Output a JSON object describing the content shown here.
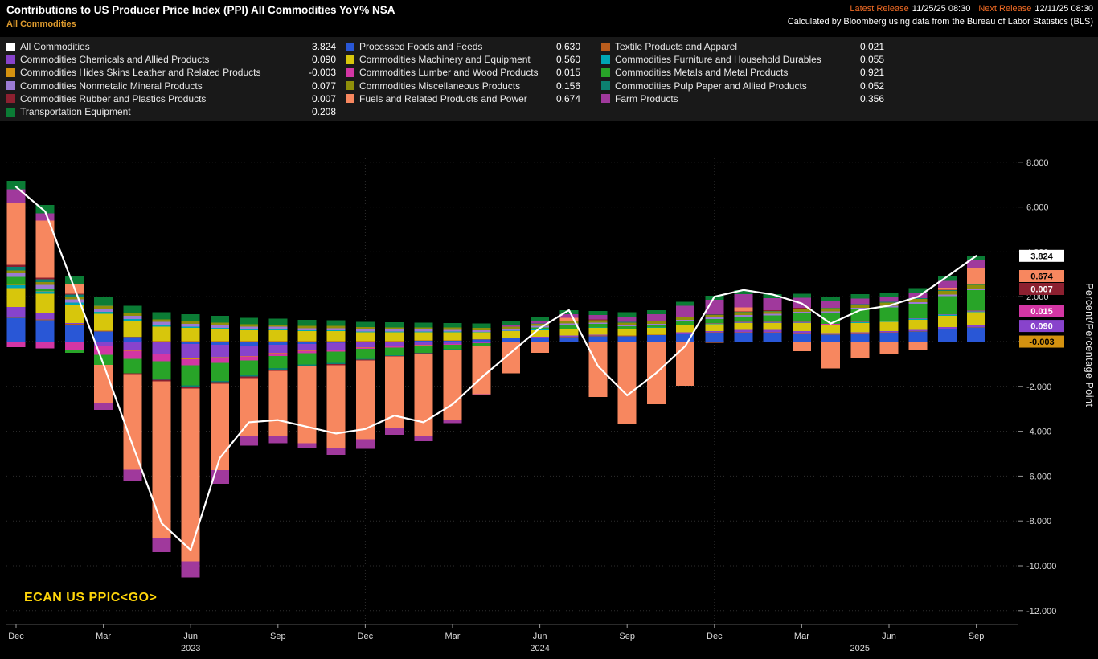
{
  "header": {
    "title": "Contributions to US Producer Price Index (PPI) All Commodities YoY% NSA",
    "subtitle": "All Commodities",
    "latest_release_label": "Latest Release",
    "latest_release_value": "11/25/25 08:30",
    "next_release_label": "Next Release",
    "next_release_value": "12/11/25 08:30",
    "attribution": "Calculated by Bloomberg using data from the Bureau of Labor Statistics (BLS)"
  },
  "footer_command": "ECAN US PPIC<GO>",
  "axis": {
    "right_title": "Percent/Percentage Point"
  },
  "legend": {
    "columns": [
      {
        "items": [
          {
            "series": "all_commodities",
            "label": "All Commodities",
            "value": "3.824"
          },
          {
            "series": "chemicals",
            "label": "Commodities Chemicals and Allied Products",
            "value": "0.090"
          },
          {
            "series": "hides",
            "label": "Commodities Hides Skins Leather and Related Products",
            "value": "-0.003"
          },
          {
            "series": "nonmetalic_minerals",
            "label": "Commodities Nonmetalic Mineral Products",
            "value": "0.077"
          },
          {
            "series": "rubber_plastics",
            "label": "Commodities Rubber and Plastics Products",
            "value": "0.007"
          },
          {
            "series": "transportation",
            "label": "Transportation Equipment",
            "value": "0.208"
          }
        ]
      },
      {
        "items": [
          {
            "series": "processed_foods",
            "label": "Processed Foods and Feeds",
            "value": "0.630"
          },
          {
            "series": "machinery",
            "label": "Commodities Machinery and Equipment",
            "value": "0.560"
          },
          {
            "series": "lumber",
            "label": "Commodities Lumber and Wood Products",
            "value": "0.015"
          },
          {
            "series": "miscellaneous",
            "label": "Commodities Miscellaneous Products",
            "value": "0.156"
          },
          {
            "series": "fuels",
            "label": "Fuels and Related Products and Power",
            "value": "0.674"
          }
        ]
      },
      {
        "items": [
          {
            "series": "textiles",
            "label": "Textile Products and Apparel",
            "value": "0.021"
          },
          {
            "series": "furniture",
            "label": "Commodities Furniture and Household Durables",
            "value": "0.055"
          },
          {
            "series": "metals",
            "label": "Commodities Metals and Metal Products",
            "value": "0.921"
          },
          {
            "series": "pulp_paper",
            "label": "Commodities Pulp Paper and Allied Products",
            "value": "0.052"
          },
          {
            "series": "farm",
            "label": "Farm Products",
            "value": "0.356"
          }
        ]
      }
    ]
  },
  "chart_data": {
    "type": "bar",
    "subtype": "stacked-bar-with-line",
    "title": "Contributions to US Producer Price Index (PPI) All Commodities YoY% NSA",
    "ylabel": "Percent/Percentage Point",
    "ylim": [
      -12.6,
      9.4
    ],
    "grid": true,
    "months": [
      "Dec 2022",
      "Jan 2023",
      "Feb 2023",
      "Mar 2023",
      "Apr 2023",
      "May 2023",
      "Jun 2023",
      "Jul 2023",
      "Aug 2023",
      "Sep 2023",
      "Oct 2023",
      "Nov 2023",
      "Dec 2023",
      "Jan 2024",
      "Feb 2024",
      "Mar 2024",
      "Apr 2024",
      "May 2024",
      "Jun 2024",
      "Jul 2024",
      "Aug 2024",
      "Sep 2024",
      "Oct 2024",
      "Nov 2024",
      "Dec 2024",
      "Jan 2025",
      "Feb 2025",
      "Mar 2025",
      "Apr 2025",
      "May 2025",
      "Jun 2025",
      "Jul 2025",
      "Aug 2025",
      "Sep 2025"
    ],
    "x_ticks": [
      {
        "index": 0,
        "label": "Dec"
      },
      {
        "index": 3,
        "label": "Mar"
      },
      {
        "index": 6,
        "label": "Jun"
      },
      {
        "index": 9,
        "label": "Sep"
      },
      {
        "index": 12,
        "label": "Dec"
      },
      {
        "index": 15,
        "label": "Mar"
      },
      {
        "index": 18,
        "label": "Jun"
      },
      {
        "index": 21,
        "label": "Sep"
      },
      {
        "index": 24,
        "label": "Dec"
      },
      {
        "index": 27,
        "label": "Mar"
      },
      {
        "index": 30,
        "label": "Jun"
      },
      {
        "index": 33,
        "label": "Sep"
      }
    ],
    "year_labels": [
      {
        "index": 6,
        "label": "2023"
      },
      {
        "index": 18,
        "label": "2024"
      },
      {
        "index": 29,
        "label": "2025"
      }
    ],
    "year_separator_indices": [
      12,
      24
    ],
    "y_ticks": [
      {
        "value": 8,
        "label": "8.000"
      },
      {
        "value": 6,
        "label": "6.000"
      },
      {
        "value": 4,
        "label": "4.000"
      },
      {
        "value": 2,
        "label": "2.000"
      },
      {
        "value": 0,
        "label": "0.000"
      },
      {
        "value": -2,
        "label": "-2.000"
      },
      {
        "value": -4,
        "label": "-4.000"
      },
      {
        "value": -6,
        "label": "-6.000"
      },
      {
        "value": -8,
        "label": "-8.000"
      },
      {
        "value": -10,
        "label": "-10.000"
      },
      {
        "value": -12,
        "label": "-12.000"
      }
    ],
    "line": {
      "key": "all_commodities",
      "name": "All Commodities",
      "color": "#ffffff",
      "latest": 3.824,
      "values": [
        6.9,
        5.8,
        2.4,
        -1.0,
        -4.6,
        -8.1,
        -9.3,
        -5.2,
        -3.6,
        -3.5,
        -3.8,
        -4.1,
        -3.9,
        -3.3,
        -3.6,
        -2.8,
        -1.6,
        -0.5,
        0.6,
        1.4,
        -1.1,
        -2.4,
        -1.4,
        -0.2,
        2.0,
        2.3,
        2.1,
        1.7,
        0.8,
        1.4,
        1.6,
        2.0,
        2.9,
        3.824
      ]
    },
    "stack_order": [
      "processed_foods",
      "textiles",
      "chemicals",
      "machinery",
      "furniture",
      "hides",
      "lumber",
      "metals",
      "nonmetalic_minerals",
      "miscellaneous",
      "pulp_paper",
      "rubber_plastics",
      "fuels",
      "farm",
      "transportation"
    ],
    "series": {
      "processed_foods": {
        "name": "Processed Foods and Feeds",
        "color": "#2957d6",
        "latest": 0.63,
        "values": [
          1.05,
          0.95,
          0.75,
          0.45,
          0.2,
          0.0,
          -0.1,
          -0.15,
          -0.2,
          -0.15,
          -0.1,
          -0.05,
          0.0,
          0.0,
          0.05,
          0.05,
          0.1,
          0.15,
          0.15,
          0.2,
          0.25,
          0.25,
          0.3,
          0.35,
          0.4,
          0.4,
          0.4,
          0.35,
          0.3,
          0.35,
          0.4,
          0.45,
          0.55,
          0.63
        ]
      },
      "textiles": {
        "name": "Textile Products and Apparel",
        "color": "#b85c1c",
        "latest": 0.021,
        "values": [
          0.04,
          0.04,
          0.03,
          0.03,
          0.02,
          0.02,
          0.01,
          0.01,
          0.01,
          0.01,
          0.01,
          0.01,
          0.01,
          0.01,
          0.01,
          0.01,
          0.01,
          0.01,
          0.01,
          0.01,
          0.01,
          0.01,
          0.01,
          0.01,
          0.02,
          0.02,
          0.02,
          0.02,
          0.02,
          0.02,
          0.02,
          0.02,
          0.02,
          0.021
        ]
      },
      "chemicals": {
        "name": "Commodities Chemicals and Allied Products",
        "color": "#8843cc",
        "latest": 0.09,
        "values": [
          0.45,
          0.3,
          0.05,
          -0.2,
          -0.4,
          -0.55,
          -0.65,
          -0.55,
          -0.45,
          -0.35,
          -0.3,
          -0.3,
          -0.25,
          -0.2,
          -0.15,
          -0.1,
          -0.05,
          0.0,
          0.05,
          0.05,
          0.05,
          0.0,
          0.0,
          0.05,
          0.05,
          0.1,
          0.1,
          0.1,
          0.05,
          0.05,
          0.05,
          0.05,
          0.08,
          0.09
        ]
      },
      "machinery": {
        "name": "Commodities Machinery and Equipment",
        "color": "#d7c60c",
        "latest": 0.56,
        "values": [
          0.85,
          0.85,
          0.8,
          0.75,
          0.7,
          0.65,
          0.6,
          0.55,
          0.5,
          0.5,
          0.45,
          0.45,
          0.4,
          0.4,
          0.35,
          0.35,
          0.3,
          0.3,
          0.3,
          0.3,
          0.3,
          0.3,
          0.3,
          0.3,
          0.3,
          0.3,
          0.3,
          0.35,
          0.35,
          0.4,
          0.4,
          0.45,
          0.5,
          0.56
        ]
      },
      "furniture": {
        "name": "Commodities Furniture and Household Durables",
        "color": "#00a7b3",
        "latest": 0.055,
        "values": [
          0.12,
          0.11,
          0.1,
          0.09,
          0.08,
          0.07,
          0.06,
          0.05,
          0.05,
          0.04,
          0.04,
          0.04,
          0.03,
          0.03,
          0.03,
          0.03,
          0.02,
          0.02,
          0.02,
          0.02,
          0.02,
          0.02,
          0.02,
          0.03,
          0.03,
          0.03,
          0.03,
          0.03,
          0.04,
          0.04,
          0.04,
          0.05,
          0.05,
          0.055
        ]
      },
      "hides": {
        "name": "Commodities Hides Skins Leather and Related Products",
        "color": "#d49210",
        "latest": -0.003,
        "values": [
          0.02,
          0.01,
          0.0,
          -0.01,
          -0.02,
          -0.02,
          -0.03,
          -0.03,
          -0.02,
          -0.02,
          -0.02,
          -0.02,
          -0.01,
          -0.01,
          -0.01,
          -0.01,
          -0.01,
          0.0,
          0.0,
          0.0,
          0.0,
          0.0,
          0.0,
          0.0,
          0.0,
          0.0,
          0.0,
          0.0,
          0.0,
          0.0,
          0.0,
          0.0,
          0.0,
          -0.003
        ]
      },
      "lumber": {
        "name": "Commodities Lumber and Wood Products",
        "color": "#d336a4",
        "latest": 0.015,
        "values": [
          -0.25,
          -0.3,
          -0.35,
          -0.38,
          -0.35,
          -0.3,
          -0.28,
          -0.22,
          -0.18,
          -0.12,
          -0.1,
          -0.08,
          -0.06,
          -0.05,
          -0.04,
          -0.03,
          -0.02,
          -0.02,
          -0.01,
          0.0,
          0.0,
          0.0,
          0.0,
          0.01,
          0.01,
          0.02,
          0.02,
          0.02,
          0.02,
          0.02,
          0.02,
          0.02,
          0.02,
          0.015
        ]
      },
      "metals": {
        "name": "Commodities Metals and Metal Products",
        "color": "#28a428",
        "latest": 0.921,
        "values": [
          0.35,
          0.1,
          -0.15,
          -0.45,
          -0.65,
          -0.8,
          -0.9,
          -0.8,
          -0.65,
          -0.55,
          -0.5,
          -0.5,
          -0.45,
          -0.35,
          -0.3,
          -0.2,
          -0.1,
          0.0,
          0.1,
          0.15,
          0.15,
          0.1,
          0.1,
          0.15,
          0.2,
          0.25,
          0.3,
          0.4,
          0.5,
          0.55,
          0.6,
          0.65,
          0.8,
          0.921
        ]
      },
      "nonmetalic_minerals": {
        "name": "Commodities Nonmetalic Mineral Products",
        "color": "#9c7bd4",
        "latest": 0.077,
        "values": [
          0.16,
          0.16,
          0.15,
          0.15,
          0.14,
          0.13,
          0.12,
          0.12,
          0.11,
          0.11,
          0.1,
          0.1,
          0.1,
          0.09,
          0.09,
          0.08,
          0.08,
          0.08,
          0.07,
          0.07,
          0.07,
          0.07,
          0.06,
          0.06,
          0.06,
          0.06,
          0.06,
          0.06,
          0.07,
          0.07,
          0.07,
          0.07,
          0.08,
          0.077
        ]
      },
      "miscellaneous": {
        "name": "Commodities Miscellaneous Products",
        "color": "#8f8f0a",
        "latest": 0.156,
        "values": [
          0.13,
          0.13,
          0.12,
          0.12,
          0.12,
          0.11,
          0.11,
          0.11,
          0.1,
          0.1,
          0.1,
          0.1,
          0.1,
          0.1,
          0.1,
          0.1,
          0.1,
          0.1,
          0.1,
          0.11,
          0.11,
          0.11,
          0.11,
          0.12,
          0.12,
          0.12,
          0.12,
          0.13,
          0.13,
          0.13,
          0.14,
          0.14,
          0.15,
          0.156
        ]
      },
      "pulp_paper": {
        "name": "Commodities Pulp Paper and Allied Products",
        "color": "#0c8170",
        "latest": 0.052,
        "values": [
          0.16,
          0.13,
          0.1,
          0.05,
          0.0,
          -0.03,
          -0.05,
          -0.06,
          -0.06,
          -0.06,
          -0.05,
          -0.05,
          -0.04,
          -0.03,
          -0.02,
          -0.01,
          0.0,
          0.0,
          0.01,
          0.01,
          0.01,
          0.01,
          0.02,
          0.02,
          0.02,
          0.03,
          0.03,
          0.03,
          0.03,
          0.04,
          0.04,
          0.04,
          0.05,
          0.052
        ]
      },
      "rubber_plastics": {
        "name": "Commodities Rubber and Plastics Products",
        "color": "#8c2030",
        "latest": 0.007,
        "values": [
          0.09,
          0.07,
          0.04,
          0.0,
          -0.04,
          -0.07,
          -0.09,
          -0.08,
          -0.07,
          -0.06,
          -0.05,
          -0.05,
          -0.04,
          -0.03,
          -0.03,
          -0.02,
          -0.01,
          0.0,
          0.0,
          0.01,
          0.01,
          0.0,
          0.0,
          0.0,
          0.01,
          0.01,
          0.01,
          0.01,
          0.0,
          0.0,
          0.0,
          0.0,
          0.01,
          0.007
        ]
      },
      "fuels": {
        "name": "Fuels and Related Products and Power",
        "color": "#f7875f",
        "latest": 0.674,
        "values": [
          2.75,
          2.55,
          0.4,
          -1.7,
          -4.25,
          -7.0,
          -7.7,
          -3.85,
          -2.6,
          -2.9,
          -3.42,
          -3.7,
          -3.51,
          -3.17,
          -3.65,
          -3.11,
          -2.15,
          -1.4,
          -0.49,
          0.13,
          -2.47,
          -3.7,
          -2.8,
          -1.98,
          -0.05,
          0.18,
          -0.02,
          -0.43,
          -1.2,
          -0.71,
          -0.55,
          -0.4,
          0.09,
          0.674
        ]
      },
      "farm": {
        "name": "Farm Products",
        "color": "#a0399c",
        "latest": 0.356,
        "values": [
          0.62,
          0.32,
          0.0,
          -0.3,
          -0.5,
          -0.62,
          -0.72,
          -0.6,
          -0.42,
          -0.32,
          -0.22,
          -0.3,
          -0.42,
          -0.32,
          -0.25,
          -0.15,
          -0.05,
          0.05,
          0.1,
          0.15,
          0.2,
          0.25,
          0.3,
          0.5,
          0.65,
          0.6,
          0.55,
          0.45,
          0.3,
          0.25,
          0.2,
          0.25,
          0.3,
          0.356
        ]
      },
      "transportation": {
        "name": "Transportation Equipment",
        "color": "#0b7c35",
        "latest": 0.208,
        "values": [
          0.38,
          0.38,
          0.36,
          0.35,
          0.33,
          0.32,
          0.31,
          0.3,
          0.28,
          0.27,
          0.26,
          0.25,
          0.24,
          0.23,
          0.22,
          0.21,
          0.2,
          0.2,
          0.19,
          0.19,
          0.19,
          0.18,
          0.18,
          0.18,
          0.18,
          0.18,
          0.18,
          0.18,
          0.19,
          0.19,
          0.19,
          0.2,
          0.2,
          0.208
        ]
      }
    },
    "badges": [
      {
        "series": "all_commodities",
        "label": "3.824",
        "bg": "#ffffff",
        "fg": "#000000"
      },
      {
        "series": "fuels",
        "label": "0.674",
        "bg": "#f7875f",
        "fg": "#000000"
      },
      {
        "series": "rubber_plastics",
        "label": "0.007",
        "bg": "#8c2030",
        "fg": "#ffffff"
      },
      {
        "series": "lumber",
        "label": "0.015",
        "bg": "#d336a4",
        "fg": "#ffffff"
      },
      {
        "series": "chemicals",
        "label": "0.090",
        "bg": "#8843cc",
        "fg": "#ffffff"
      },
      {
        "series": "hides",
        "label": "-0.003",
        "bg": "#d49210",
        "fg": "#000000"
      }
    ]
  }
}
